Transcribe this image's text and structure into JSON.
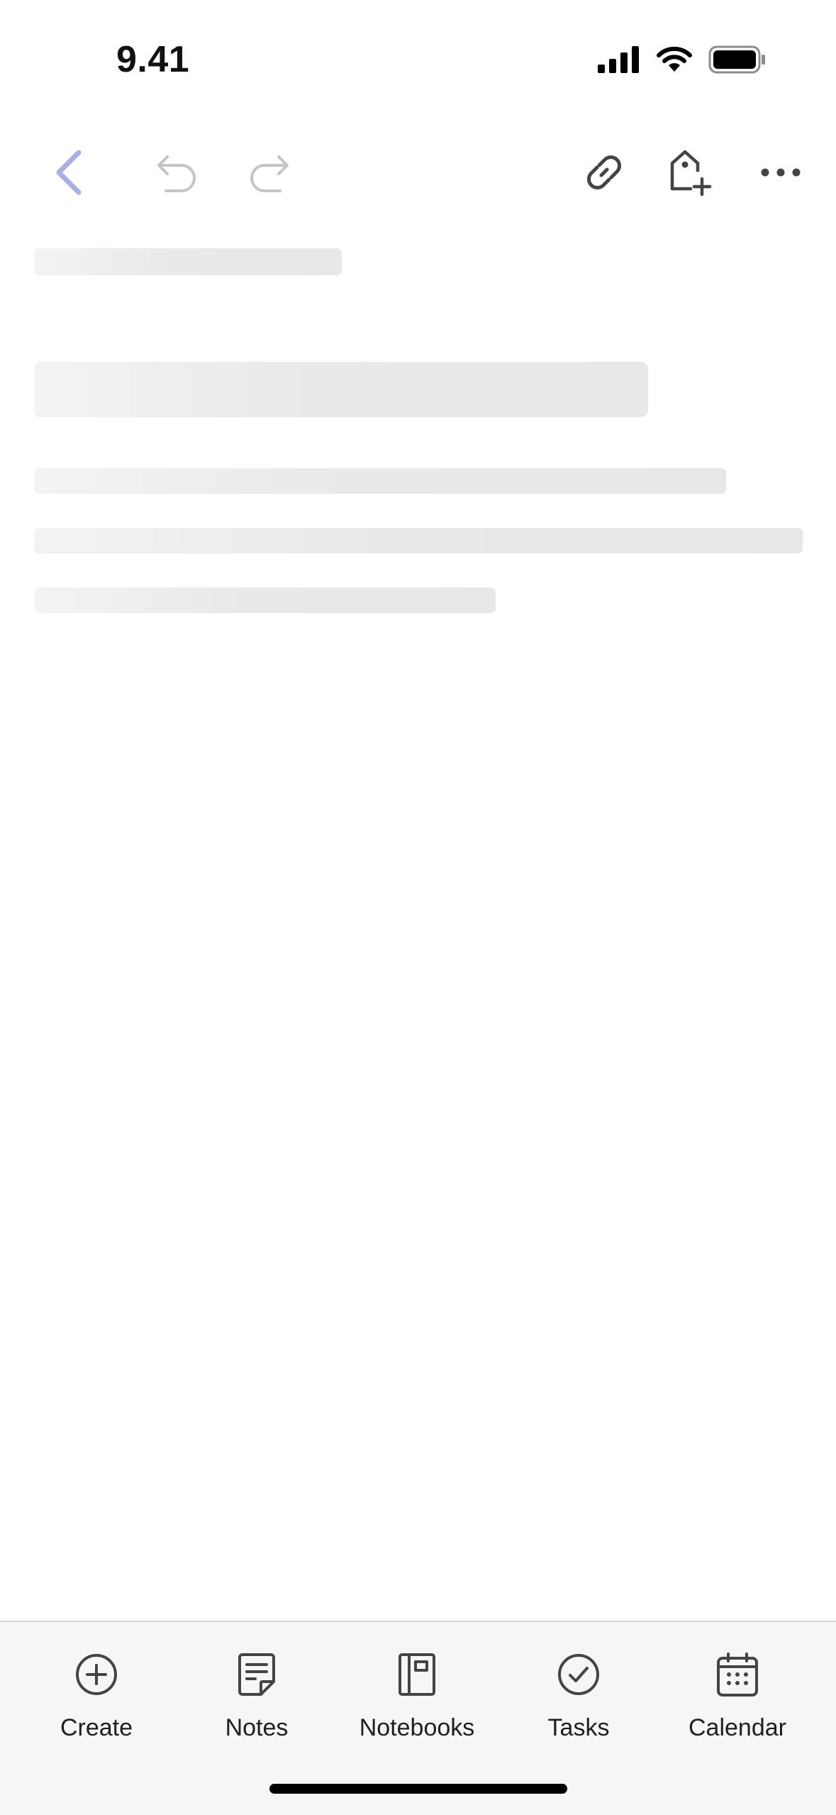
{
  "status_bar": {
    "time": "9.41",
    "icons": [
      "cellular-signal-icon",
      "wifi-icon",
      "battery-icon"
    ]
  },
  "toolbar": {
    "buttons": [
      "back-icon",
      "undo-icon",
      "redo-icon",
      "link-icon",
      "add-tag-icon",
      "more-icon"
    ],
    "accent_color": "#a9aee3",
    "disabled_color": "#c4c4c4",
    "icon_color": "#444444"
  },
  "content": {
    "state": "loading",
    "skeleton_color": "#e9e9e9"
  },
  "tab_bar": {
    "tabs": [
      {
        "label": "Create",
        "icon": "plus-circle-icon"
      },
      {
        "label": "Notes",
        "icon": "note-icon"
      },
      {
        "label": "Notebooks",
        "icon": "notebook-icon"
      },
      {
        "label": "Tasks",
        "icon": "check-circle-icon"
      },
      {
        "label": "Calendar",
        "icon": "calendar-icon"
      }
    ]
  }
}
